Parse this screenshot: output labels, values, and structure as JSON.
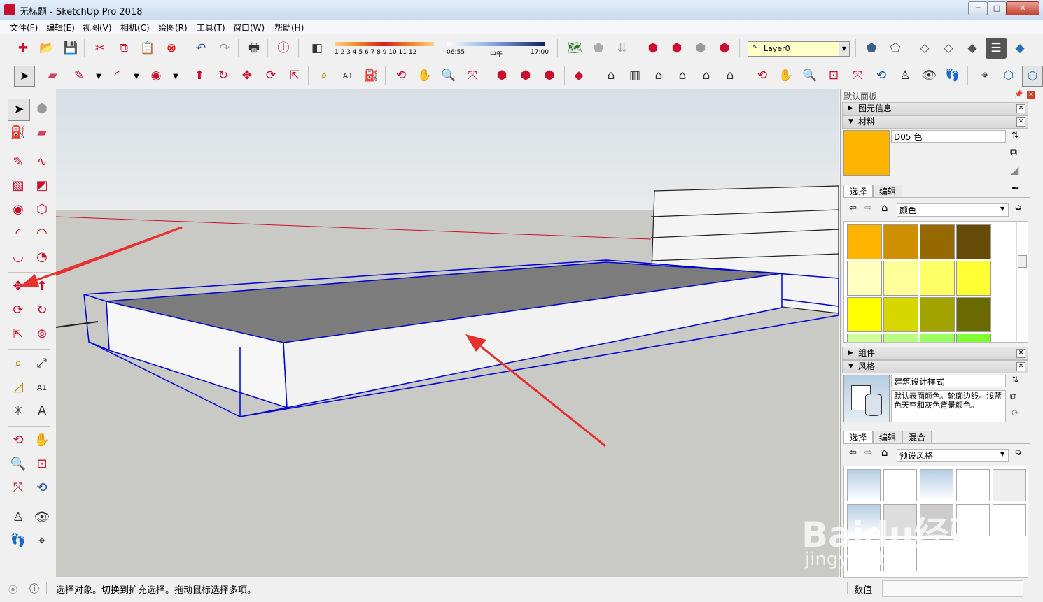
{
  "window": {
    "title": "无标题 - SketchUp Pro 2018",
    "minimize": "─",
    "maximize": "□",
    "close": "✕"
  },
  "menu": [
    "文件(F)",
    "编辑(E)",
    "视图(V)",
    "相机(C)",
    "绘图(R)",
    "工具(T)",
    "窗口(W)",
    "帮助(H)"
  ],
  "shadow_bar": {
    "months": "1 2 3 4 5 6 7 8 9 10 11 12",
    "time_start": "06:55",
    "time_mid": "中午",
    "time_end": "17:00"
  },
  "layer": {
    "current": "Layer0"
  },
  "toolbar1_icons": [
    "new-icon",
    "open-icon",
    "save-icon",
    "cut-icon",
    "copy-icon",
    "paste-icon",
    "erase-icon",
    "undo-icon",
    "redo-icon",
    "print-icon",
    "model-info-icon",
    "shadow-icon",
    "location-icon",
    "fog-icon",
    "section-icon",
    "warehouse-icon",
    "share-icon",
    "extension-icon",
    "ruby-icon",
    "layer-manager-icon",
    "view-iso-icon",
    "view-top-icon",
    "view-front-icon",
    "view-right-icon",
    "view-back-icon",
    "view-left-icon",
    "xray-icon",
    "wireframe-icon"
  ],
  "panel": {
    "title": "默认面板",
    "entity_info": "图元信息",
    "materials": "材料",
    "material_name": "D05 色",
    "materials_tab_select": "选择",
    "materials_tab_edit": "编辑",
    "material_library": "颜色",
    "components": "组件",
    "styles": "风格",
    "style_name": "建筑设计样式",
    "style_desc": "默认表面颜色。轮廓边线。浅蓝色天空和灰色背景颜色。",
    "styles_tab_select": "选择",
    "styles_tab_edit": "编辑",
    "styles_tab_mix": "混合",
    "style_library": "预设风格"
  },
  "swatches": [
    "#ffb400",
    "#cf9000",
    "#966900",
    "#654a08",
    "#ffffc0",
    "#ffff99",
    "#ffff66",
    "#ffff33",
    "#ffff00",
    "#d7d700",
    "#a3a300",
    "#6a6a00",
    "#d0ff9a",
    "#b6ff80",
    "#9aff60",
    "#80ff30"
  ],
  "colors": {
    "material_active": "#ffb400",
    "selection_blue": "#0000d0",
    "arrow_red": "#e8302f"
  },
  "status": {
    "message": "选择对象。切换到扩充选择。拖动鼠标选择多项。",
    "measure_label": "数值"
  },
  "watermark": {
    "brand": "Baidu经验",
    "url": "jingyan.baidu.com"
  }
}
